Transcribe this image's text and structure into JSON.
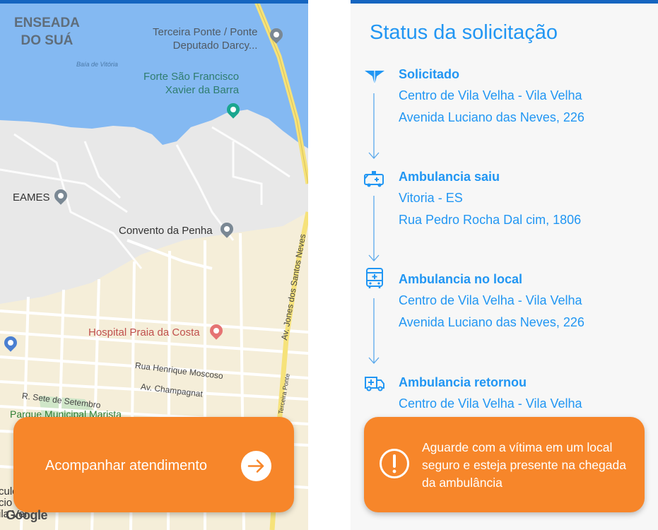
{
  "map": {
    "labels": {
      "bay": "ENSEADA\nDO SUÁ",
      "bridge": "Terceira Ponte / Ponte\nDeputado Darcy...",
      "bay_small": "Baía de Vitória",
      "forte": "Forte São Francisco\nXavier da Barra",
      "eames": "EAMES",
      "convento": "Convento da Penha",
      "hospital": "Hospital Praia da Costa",
      "henrique": "Rua Henrique Moscoso",
      "champagnat": "Av. Champagnat",
      "setembro": "R. Sete de Setembro",
      "parque": "Parque Municipal Marista",
      "jones": "Av. Jones dos Santos Neves",
      "terceira": "Terceira Ponte",
      "bottom_left": "culo\ncio de\nila Vel",
      "google": "Google"
    },
    "action_label": "Acompanhar atendimento",
    "colors": {
      "water": "#84b9f2",
      "land": "#e8e8e8",
      "urban": "#f5eed9",
      "highway": "#f6e27a",
      "accent": "#f7862a",
      "topbar": "#1565c0"
    }
  },
  "status": {
    "title": "Status da solicitação",
    "steps": [
      {
        "icon": "plane-icon",
        "title": "Solicitado",
        "lines": [
          "Centro de Vila Velha - Vila Velha",
          "Avenida Luciano das Neves, 226"
        ]
      },
      {
        "icon": "ambulance-icon",
        "title": "Ambulancia saiu",
        "lines": [
          "Vitoria - ES",
          "Rua Pedro Rocha Dal cim, 1806"
        ]
      },
      {
        "icon": "bus-icon",
        "title": "Ambulancia no local",
        "lines": [
          "Centro de Vila Velha - Vila Velha",
          "Avenida Luciano das Neves, 226"
        ]
      },
      {
        "icon": "ambulance-return-icon",
        "title": "Ambulancia retornou",
        "lines": [
          "Centro de Vila Velha - Vila Velha"
        ]
      }
    ],
    "notice": "Aguarde com a vítima em um local seguro e esteja presente na chegada da ambulância",
    "colors": {
      "text": "#2196f3",
      "card": "#f7862a",
      "background": "#f7f7f7"
    }
  }
}
